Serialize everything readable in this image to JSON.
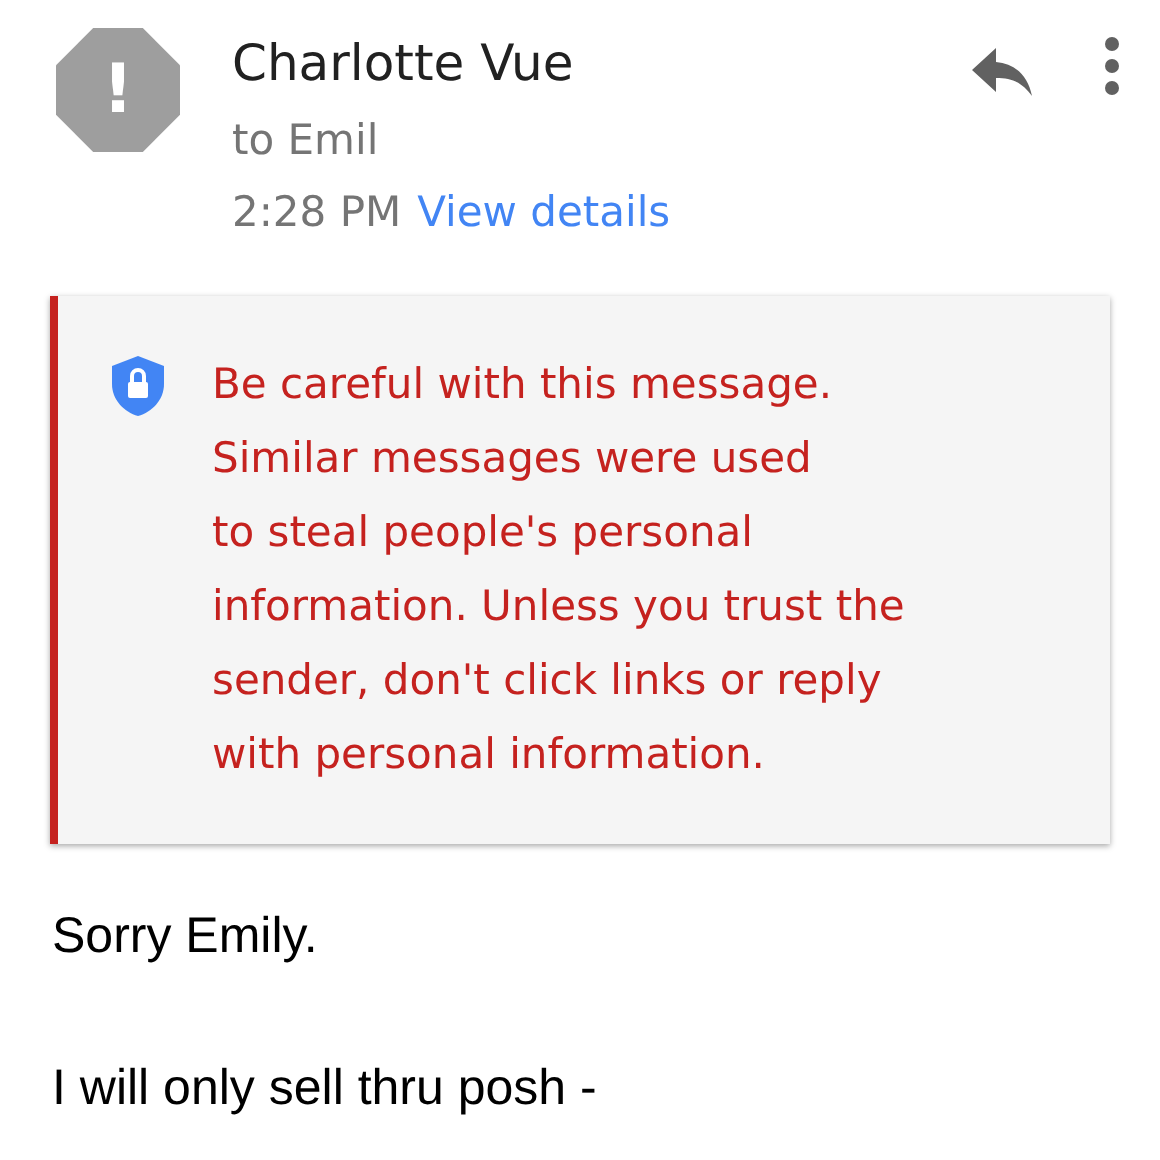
{
  "header": {
    "avatar_mark": "!",
    "sender": "Charlotte Vue",
    "recipient": "to Emil",
    "time": "2:28 PM",
    "details_link": "View details"
  },
  "warning": {
    "text": "Be careful with this message.\nSimilar messages were used\nto steal people's personal\ninformation. Unless you trust the\nsender, don't click links or reply\nwith personal information."
  },
  "body": [
    "Sorry Emily.",
    "I will only sell thru posh -"
  ]
}
